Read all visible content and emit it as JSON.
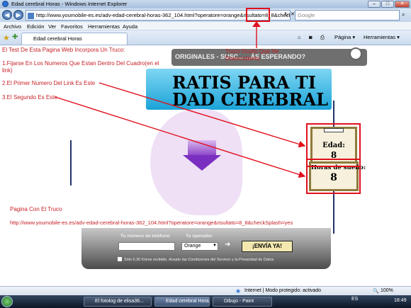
{
  "window": {
    "title": "Edad cerebral Horas - Windows Internet Explorer",
    "minimize": "–",
    "maximize": "□",
    "close": "✕"
  },
  "address": {
    "url": "http://www.youmobile-es.es/adv-edad-cerebral-horas-362_104.html?operatore=orange&risultato=8_8&checkSplash",
    "refresh": "↻",
    "stop": "✕",
    "search_placeholder": "Google"
  },
  "menu": [
    "Archivo",
    "Edición",
    "Ver",
    "Favoritos",
    "Herramientas",
    "Ayuda"
  ],
  "tab": {
    "label": "Edad cerebral Horas",
    "page_menu": "Página ▾",
    "tools_menu": "Herramientas ▾"
  },
  "content": {
    "banner_text": "ORIGINALES - SUSC...           ...ÁS ESPERANDO?",
    "headline1": "RATIS PARA TI",
    "headline2": "DAD CEREBRAL",
    "clip1_label": "Edad:",
    "clip1_value": "8",
    "clip2_label": "Horas de sueño:",
    "clip2_value": "8",
    "phone_label": "Tu número de teléfono",
    "operator_label": "Tu operador",
    "operator_value": "Orange",
    "send_button": "¡ENVÍA YA!",
    "legal_text": "Sólo 0.30 €/sms recibido. Acepto las Condiciones del Servicio y la Privacidad de Datos"
  },
  "annotations": {
    "line1": "El Test De Esta Pagina Web Incorpora Un Truco:",
    "line2a": "1.Fijarse En Los Numeros Que Estan Dentro Del Cuadro(en el",
    "line2b": "link)",
    "line3": "2.El Primer Numero Del Link Es Este",
    "line4": "3.El Segundo Es Este",
    "truco_a": "Truco Oculto Que He",
    "truco_b": "Dwescubierto",
    "pagina_label": "Pagina Con El Truco",
    "pagina_url": "http://www.youmobile-es.es/adv-edad-cerebral-horas-362_104.html?operatore=orange&risultato=8_8&checkSplash=yes"
  },
  "status": {
    "zone": "Internet | Modo protegido: activado",
    "zoom": "100%"
  },
  "taskbar": {
    "tasks": [
      "El fotolog de elisa36...",
      "Edad cerebral Horas...",
      "Dibujo - Paint"
    ],
    "lang": "ES",
    "time": "18:49"
  }
}
